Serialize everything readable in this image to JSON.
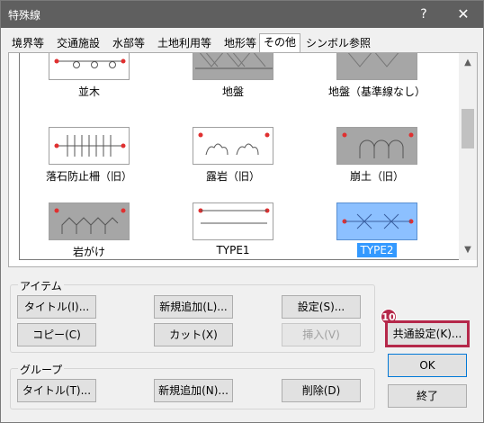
{
  "window": {
    "title": "特殊線",
    "help": "?",
    "close": "✕"
  },
  "tabs": [
    "境界等",
    "交通施設",
    "水部等",
    "土地利用等",
    "地形等",
    "その他",
    "シンボル参照"
  ],
  "active_tab": "その他",
  "items": [
    {
      "label": "並木"
    },
    {
      "label": "地盤"
    },
    {
      "label": "地盤（基準線なし）"
    },
    {
      "label": "落石防止柵（旧）"
    },
    {
      "label": "露岩（旧）"
    },
    {
      "label": "崩土（旧）"
    },
    {
      "label": "岩がけ"
    },
    {
      "label": "TYPE1"
    },
    {
      "label": "TYPE2",
      "selected": true
    }
  ],
  "item_group": {
    "legend": "アイテム",
    "title": "タイトル(I)...",
    "new": "新規追加(L)...",
    "settings": "設定(S)...",
    "copy": "コピー(C)",
    "cut": "カット(X)",
    "insert": "挿入(V)"
  },
  "group_group": {
    "legend": "グループ",
    "title": "タイトル(T)...",
    "new": "新規追加(N)...",
    "delete": "削除(D)"
  },
  "side": {
    "common": "共通設定(K)...",
    "ok": "OK",
    "end": "終了",
    "badge": "10"
  },
  "colors": {
    "titlebar": "#5f5f5f",
    "accent": "#b5284a",
    "selection": "#3399ff"
  }
}
